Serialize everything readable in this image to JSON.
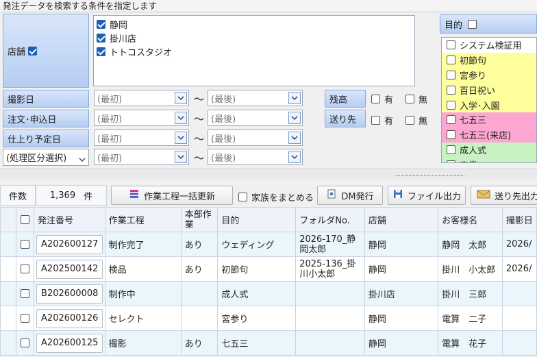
{
  "header": {
    "title": "発注データを検索する条件を指定します"
  },
  "store": {
    "label": "店舗",
    "checked": true,
    "items": [
      {
        "label": "静岡",
        "checked": true
      },
      {
        "label": "掛川店",
        "checked": true
      },
      {
        "label": "トトコスタジオ",
        "checked": true
      }
    ]
  },
  "date_filters": [
    {
      "label": "撮影日",
      "from_placeholder": "(最初)",
      "to_placeholder": "(最後)"
    },
    {
      "label": "注文･申込日",
      "from_placeholder": "(最初)",
      "to_placeholder": "(最後)"
    },
    {
      "label": "仕上り予定日",
      "from_placeholder": "(最初)",
      "to_placeholder": "(最後)"
    },
    {
      "label": "(処理区分選択)",
      "from_placeholder": "(最初)",
      "to_placeholder": "(最後)"
    }
  ],
  "range_separator": "～",
  "balance": {
    "label": "残高",
    "yes": "有",
    "no": "無"
  },
  "destination": {
    "label": "送り先",
    "yes": "有",
    "no": "無"
  },
  "purpose": {
    "label": "目的",
    "items": [
      {
        "label": "システム検証用",
        "color": "#ffffff"
      },
      {
        "label": "初節句",
        "color": "#fefe9c"
      },
      {
        "label": "宮参り",
        "color": "#fefe9c"
      },
      {
        "label": "百日祝い",
        "color": "#fefe9c"
      },
      {
        "label": "入学･入園",
        "color": "#fefe9c"
      },
      {
        "label": "七五三",
        "color": "#fca7d2"
      },
      {
        "label": "七五三(来店)",
        "color": "#fca7d2"
      },
      {
        "label": "成人式",
        "color": "#c9f2c2"
      },
      {
        "label": "卒業",
        "color": "#c9f2c2"
      }
    ]
  },
  "toolbar": {
    "count_label": "件数",
    "count_value": "1,369",
    "count_unit": "件",
    "bulk_update": "作業工程一括更新",
    "family_label": "家族をまとめる",
    "dm_issue": "DM発行",
    "file_output": "ファイル出力",
    "destination_output": "送り先出力"
  },
  "table": {
    "columns": [
      "発注番号",
      "作業工程",
      "本部作業",
      "目的",
      "フォルダNo.",
      "店舗",
      "お客様名",
      "撮影日"
    ],
    "rows": [
      {
        "order": "A202600127",
        "process": "制作完了",
        "hq": "あり",
        "purpose": "ウェディング",
        "folder": "2026-170_静岡太郎",
        "store": "静岡",
        "customer": "静岡　太郎",
        "shoot": "2026/"
      },
      {
        "order": "A202500142",
        "process": "検品",
        "hq": "あり",
        "purpose": "初節句",
        "folder": "2025-136_掛川小太郎",
        "store": "静岡",
        "customer": "掛川　小太郎",
        "shoot": "2026/"
      },
      {
        "order": "B202600008",
        "process": "制作中",
        "hq": "",
        "purpose": "成人式",
        "folder": "",
        "store": "掛川店",
        "customer": "掛川　三郎",
        "shoot": ""
      },
      {
        "order": "A202600126",
        "process": "セレクト",
        "hq": "",
        "purpose": "宮参り",
        "folder": "",
        "store": "静岡",
        "customer": "電算　二子",
        "shoot": ""
      },
      {
        "order": "A202600125",
        "process": "撮影",
        "hq": "あり",
        "purpose": "七五三",
        "folder": "",
        "store": "静岡",
        "customer": "電算　花子",
        "shoot": ""
      }
    ]
  }
}
